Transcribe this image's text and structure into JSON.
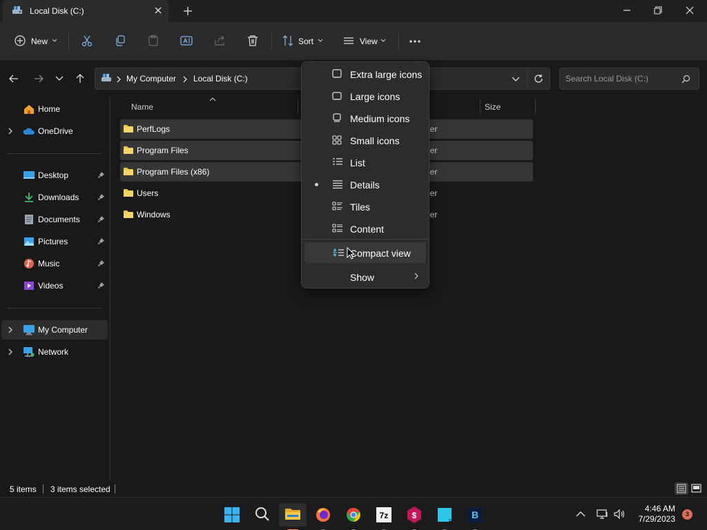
{
  "window": {
    "tab_title": "Local Disk (C:)",
    "minimize_label": "Minimize",
    "maximize_label": "Restore",
    "close_label": "Close"
  },
  "commandbar": {
    "new_label": "New",
    "sort_label": "Sort",
    "view_label": "View"
  },
  "address": {
    "breadcrumbs": [
      "My Computer",
      "Local Disk (C:)"
    ],
    "search_placeholder": "Search Local Disk (C:)"
  },
  "sidebar": {
    "items": [
      {
        "label": "Home",
        "icon": "home-icon"
      },
      {
        "label": "OneDrive",
        "icon": "cloud-icon"
      },
      {
        "label": "Desktop",
        "icon": "desktop-icon",
        "pinned": true
      },
      {
        "label": "Downloads",
        "icon": "download-icon",
        "pinned": true
      },
      {
        "label": "Documents",
        "icon": "document-icon",
        "pinned": true
      },
      {
        "label": "Pictures",
        "icon": "picture-icon",
        "pinned": true
      },
      {
        "label": "Music",
        "icon": "music-icon",
        "pinned": true
      },
      {
        "label": "Videos",
        "icon": "video-icon",
        "pinned": true
      },
      {
        "label": "My Computer",
        "icon": "computer-icon",
        "active": true
      },
      {
        "label": "Network",
        "icon": "network-icon"
      }
    ]
  },
  "filelist": {
    "columns": {
      "name": "Name",
      "size": "Size"
    },
    "rows": [
      {
        "name": "PerfLogs",
        "type_fragment": "ler",
        "selected": true
      },
      {
        "name": "Program Files",
        "type_fragment": "ler",
        "selected": true
      },
      {
        "name": "Program Files (x86)",
        "type_fragment": "ler",
        "selected": true
      },
      {
        "name": "Users",
        "type_fragment": "ler",
        "selected": false
      },
      {
        "name": "Windows",
        "type_fragment": "ler",
        "selected": false
      }
    ]
  },
  "status": {
    "items_count": "5 items",
    "selected_count": "3 items selected"
  },
  "view_menu": {
    "items": [
      {
        "label": "Extra large icons",
        "icon": "extra-large-icons-icon"
      },
      {
        "label": "Large icons",
        "icon": "large-icons-icon"
      },
      {
        "label": "Medium icons",
        "icon": "medium-icons-icon"
      },
      {
        "label": "Small icons",
        "icon": "small-icons-icon"
      },
      {
        "label": "List",
        "icon": "list-view-icon"
      },
      {
        "label": "Details",
        "icon": "details-view-icon",
        "checked": true
      },
      {
        "label": "Tiles",
        "icon": "tiles-view-icon"
      },
      {
        "label": "Content",
        "icon": "content-view-icon"
      },
      {
        "label": "Compact view",
        "icon": "compact-view-icon",
        "hovered": true
      },
      {
        "label": "Show",
        "icon": "",
        "submenu": true
      }
    ]
  },
  "taskbar": {
    "time": "4:46 AM",
    "date": "7/29/2023",
    "notification_count": "3"
  },
  "colors": {
    "accent": "#60cdff",
    "folder": "#f0c44c",
    "notification": "#e06c57"
  }
}
